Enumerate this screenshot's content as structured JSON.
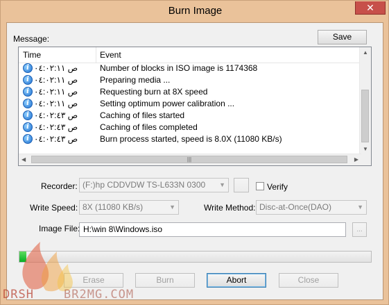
{
  "window": {
    "title": "Burn Image",
    "close_glyph": "✕"
  },
  "message": {
    "label": "Message:",
    "save_label": "Save",
    "columns": {
      "time": "Time",
      "event": "Event"
    },
    "rows": [
      {
        "time": "ص ٠٤:٠٢:١١",
        "event": "Number of blocks in ISO image is 1174368",
        "icon": "info-icon"
      },
      {
        "time": "ص ٠٤:٠٢:١١",
        "event": "Preparing media ...",
        "icon": "info-icon"
      },
      {
        "time": "ص ٠٤:٠٢:١١",
        "event": "Requesting burn at 8X speed",
        "icon": "info-icon"
      },
      {
        "time": "ص ٠٤:٠٢:١١",
        "event": "Setting optimum power calibration ...",
        "icon": "info-icon"
      },
      {
        "time": "ص ٠٤:٠٢:٤٣",
        "event": "Caching of files started",
        "icon": "info-icon"
      },
      {
        "time": "ص ٠٤:٠٢:٤٣",
        "event": "Caching of files completed",
        "icon": "info-icon"
      },
      {
        "time": "ص ٠٤:٠٢:٤٣",
        "event": "Burn process started, speed is 8.0X (11080 KB/s)",
        "icon": "info-icon"
      }
    ]
  },
  "recorder": {
    "label": "Recorder:",
    "value": "(F:)hp     CDDVDW TS-L633N 0300",
    "verify_label": "Verify",
    "verify_checked": false
  },
  "write_speed": {
    "label": "Write Speed:",
    "value": "8X (11080 KB/s)"
  },
  "write_method": {
    "label": "Write Method:",
    "value": "Disc-at-Once(DAO)"
  },
  "image_file": {
    "label": "Image File:",
    "value": "H:\\win 8\\Windows.iso",
    "browse_label": "..."
  },
  "progress": {
    "fraction": 0.02
  },
  "buttons": {
    "erase": "Erase",
    "burn": "Burn",
    "abort": "Abort",
    "close": "Close"
  },
  "watermark": {
    "left": "DRSH",
    "right": "BR2MG.COM"
  },
  "colors": {
    "accent": "#3c7fb1",
    "progress": "#06b025",
    "titlebar": "#eac29a",
    "close": "#c7504a"
  }
}
